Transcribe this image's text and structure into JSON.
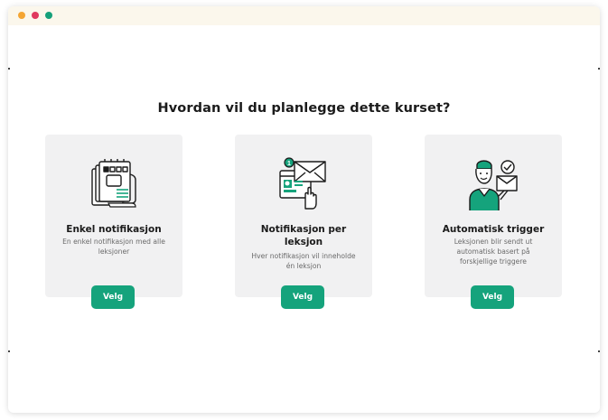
{
  "window": {
    "traffic_lights": [
      "#f4a533",
      "#e0395f",
      "#15a07a"
    ]
  },
  "question": "Hvordan vil du planlegge dette kurset?",
  "cards": [
    {
      "icon": "document-stack-icon",
      "title": "Enkel notifikasjon",
      "description": "En enkel notifikasjon med alle leksjoner",
      "button_label": "Velg"
    },
    {
      "icon": "envelope-browser-icon",
      "title": "Notifikasjon per leksjon",
      "description": "Hver notifikasjon vil inneholde én leksjon",
      "button_label": "Velg"
    },
    {
      "icon": "person-mail-check-icon",
      "title": "Automatisk trigger",
      "description": "Leksjonen blir sendt ut automatisk basert på forskjellige triggere",
      "button_label": "Velg"
    }
  ],
  "colors": {
    "accent": "#15a37c",
    "card_bg": "#f1f1f2",
    "titlebar_bg": "#fbf7ec"
  }
}
